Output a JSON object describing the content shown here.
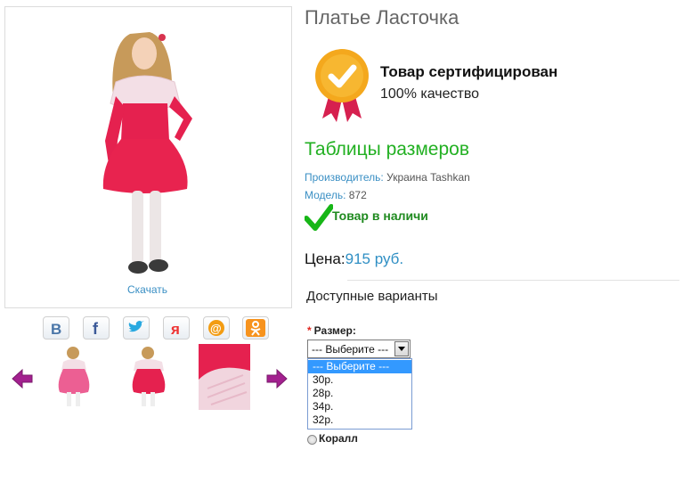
{
  "product": {
    "title": "Платье Ласточка",
    "download_label": "Скачать"
  },
  "certificate": {
    "title": "Товар сертифицирован",
    "subtitle": "100% качество"
  },
  "size_table_label": "Таблицы размеров",
  "meta": {
    "manufacturer_label": "Производитель:",
    "manufacturer_value": "Украина Tashkan",
    "model_label": "Модель:",
    "model_value": "872"
  },
  "stock_status": "Товар в наличи",
  "price": {
    "label": "Цена:",
    "value": "915 руб."
  },
  "variants_heading": "Доступные варианты",
  "size_field": {
    "required_mark": "*",
    "label": "Размер:",
    "selected": "--- Выберите ---",
    "options": [
      "--- Выберите ---",
      "30р.",
      "28р.",
      "34р.",
      "32р."
    ]
  },
  "color_option": "Коралл",
  "social": [
    "vk-icon",
    "facebook-icon",
    "twitter-icon",
    "yaru-icon",
    "mailru-icon",
    "odnoklassniki-icon"
  ],
  "colors": {
    "accent_green": "#22b022",
    "link_blue": "#3a8fc4",
    "dress_red": "#e8234f"
  }
}
